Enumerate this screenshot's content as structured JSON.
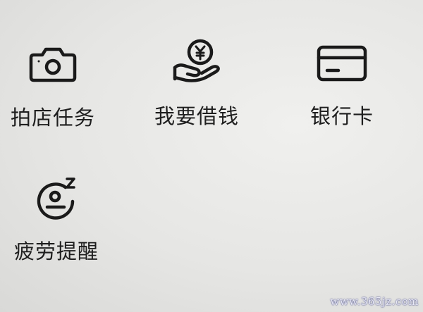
{
  "menu": {
    "items": [
      {
        "label": "拍店任务",
        "icon": "camera-icon"
      },
      {
        "label": "我要借钱",
        "icon": "yuan-coin-hand-icon"
      },
      {
        "label": "银行卡",
        "icon": "bank-card-icon"
      },
      {
        "label": "疲劳提醒",
        "icon": "fatigue-sleep-icon"
      }
    ]
  },
  "watermark": {
    "text": "www.365jz.com"
  },
  "colors": {
    "icon_stroke": "#1a1a1a",
    "label": "#1e1e1e",
    "background": "#e6e6e4"
  }
}
